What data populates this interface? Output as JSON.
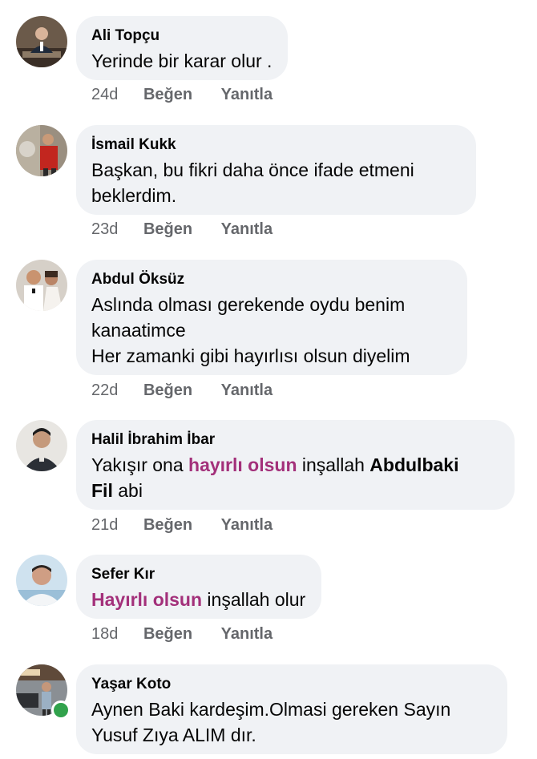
{
  "comments": [
    {
      "name": "Ali Topçu",
      "text": "Yerinde bir karar olur .",
      "time": "24d",
      "like": "Beğen",
      "reply": "Yanıtla"
    },
    {
      "name": "İsmail Kukk",
      "text_line1": "Başkan, bu fikri daha önce ifade etmeni",
      "text_line2": "beklerdim.",
      "time": "23d",
      "like": "Beğen",
      "reply": "Yanıtla"
    },
    {
      "name": "Abdul Öksüz",
      "text_line1": "Aslında olması gerekende oydu benim",
      "text_line2": "kanaatimce",
      "text_line3": "Her zamanki gibi hayırlısı olsun diyelim",
      "time": "22d",
      "like": "Beğen",
      "reply": "Yanıtla"
    },
    {
      "name": "Halil İbrahim İbar",
      "seg1": "Yakışır ona ",
      "seg2_highlight": "hayırlı olsun",
      "seg3": " inşallah ",
      "seg4_bold": "Abdulbaki",
      "seg5_bold": "Fil",
      "seg6": " abi",
      "time": "21d",
      "like": "Beğen",
      "reply": "Yanıtla"
    },
    {
      "name": "Sefer Kır",
      "seg1_highlight": "Hayırlı olsun",
      "seg2": " inşallah olur",
      "time": "18d",
      "like": "Beğen",
      "reply": "Yanıtla"
    },
    {
      "name": "Yaşar Koto",
      "text_line1": "Aynen Baki kardeşim.Olmasi gereken Sayın",
      "text_line2": "Yusuf Zıya ALIM dır.",
      "online": true
    }
  ],
  "colors": {
    "bubble": "#f0f2f5",
    "highlight": "#a3307a",
    "meta": "#65676b",
    "online": "#31a24c"
  },
  "icons": {
    "avatar": "profile-photo",
    "online": "online-status-dot"
  }
}
